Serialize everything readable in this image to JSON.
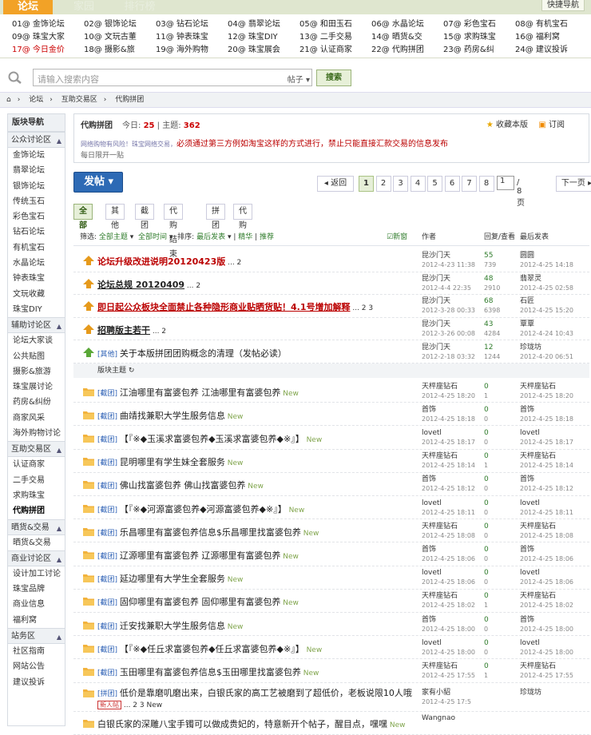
{
  "topnav": {
    "active": "论坛",
    "home": "家园",
    "rank": "排行榜",
    "quick": "快捷导航"
  },
  "forum_list": [
    [
      "01@ 金饰论坛",
      "02@ 银饰论坛",
      "03@ 钻石论坛",
      "04@ 翡翠论坛",
      "05@ 和田玉石",
      "06@ 水晶论坛",
      "07@ 彩色宝石",
      "08@ 有机宝石"
    ],
    [
      "09@ 珠宝大家",
      "10@ 文玩古董",
      "11@ 钟表珠宝",
      "12@ 珠宝DIY",
      "13@ 二手交易",
      "14@ 晒货&交",
      "15@ 求购珠宝",
      "16@ 福利窝"
    ],
    [
      "17@ 今日金价",
      "18@ 摄影&旅",
      "19@ 海外购物",
      "20@ 珠宝展会",
      "21@ 认证商家",
      "22@ 代购拼团",
      "23@ 药房&纠",
      "24@ 建议投诉"
    ]
  ],
  "search": {
    "placeholder": "请输入搜索内容",
    "scope": "帖子",
    "button": "搜索"
  },
  "breadcrumb": [
    "论坛",
    "互助交易区",
    "代购拼团"
  ],
  "sidebar": {
    "title": "版块导航",
    "groups": [
      {
        "name": "公众讨论区",
        "items": [
          "金饰论坛",
          "翡翠论坛",
          "银饰论坛",
          "传统玉石",
          "彩色宝石",
          "钻石论坛",
          "有机宝石",
          "水晶论坛",
          "钟表珠宝",
          "文玩收藏",
          "珠宝DIY"
        ]
      },
      {
        "name": "辅助讨论区",
        "items": [
          "论坛大家谈",
          "公共贴图",
          "摄影&旅游",
          "珠宝展讨论",
          "药房&纠纷",
          "商家风采",
          "海外购物讨论"
        ]
      },
      {
        "name": "互助交易区",
        "items": [
          "认证商家",
          "二手交易",
          "求购珠宝",
          "代购拼团"
        ]
      },
      {
        "name": "晒货&交易",
        "items": [
          "晒货&交易"
        ]
      },
      {
        "name": "商业讨论区",
        "items": [
          "设计加工讨论",
          "珠宝品牌",
          "商业信息",
          "福利窝"
        ]
      },
      {
        "name": "站务区",
        "items": [
          "社区指南",
          "网站公告",
          "建议投诉"
        ]
      }
    ]
  },
  "board": {
    "name": "代购拼团",
    "today_label": "今日:",
    "today": "25",
    "topics_label": "主题:",
    "topics": "362",
    "fav": "收藏本版",
    "subscribe": "订阅",
    "warning_prefix": "网络购物有风险！珠宝网络交易，",
    "warning": "必须通过第三方例如淘宝这样的方式进行，禁止只能直接汇款交易的信息发布",
    "daily": "每日限开一贴"
  },
  "post_button": "发帖",
  "pager": {
    "prev": "返回",
    "pages": [
      "1",
      "2",
      "3",
      "4",
      "5",
      "6",
      "7",
      "8"
    ],
    "input": "1",
    "total": "/ 8 页",
    "next": "下一页"
  },
  "filters": [
    "全部",
    "其他",
    "截团",
    "代购结束",
    "拼团",
    "代购"
  ],
  "thead": {
    "filter": "筛选:",
    "all_topics": "全部主题",
    "all_time": "全部时间",
    "sort": "排序:",
    "latest": "最后发表",
    "digest": "精华",
    "recommend": "推荐",
    "newwin": "新窗",
    "author": "作者",
    "replies": "回复/查看",
    "last": "最后发表"
  },
  "sticky": [
    {
      "tag": "",
      "title": "论坛升级改进说明20120423版",
      "pages": "... 2",
      "author": "昆沙门天",
      "date": "2012-4-23 11:38",
      "r": "55",
      "v": "739",
      "lp": "圆圆",
      "lpd": "2012-4-25 14:18",
      "style": "red"
    },
    {
      "tag": "",
      "title": "论坛总规 20120409",
      "pages": "... 2",
      "author": "昆沙门天",
      "date": "2012-4-4 22:35",
      "r": "48",
      "v": "2910",
      "lp": "翡翠灵",
      "lpd": "2012-4-25 02:58",
      "style": "und"
    },
    {
      "tag": "",
      "title": "即日起公众板块全面禁止各种隐形商业贴晒货贴！4.1号增加解释",
      "pages": "... 2  3",
      "author": "昆沙门天",
      "date": "2012-3-28 00:33",
      "r": "68",
      "v": "6398",
      "lp": "石匠",
      "lpd": "2012-4-25 15:20",
      "style": "redund"
    },
    {
      "tag": "",
      "title": "招聘版主若干",
      "pages": "... 2",
      "author": "昆沙门天",
      "date": "2012-3-26 00:08",
      "r": "43",
      "v": "4284",
      "lp": "覃覃",
      "lpd": "2012-4-24 10:43",
      "style": "und"
    },
    {
      "tag": "[其他]",
      "title": "关于本版拼团团购概念的清理（发帖必读）",
      "pages": "",
      "author": "昆沙门天",
      "date": "2012-2-18 03:32",
      "r": "12",
      "v": "1244",
      "lp": "珍珑坊",
      "lpd": "2012-4-20 06:51",
      "style": "plain"
    }
  ],
  "subsection": "版块主题",
  "threads": [
    {
      "tag": "[截团]",
      "title": "江油哪里有富婆包养  江油哪里有富婆包养",
      "new": "New",
      "author": "天枰座钻石",
      "date": "2012-4-25 18:20",
      "r": "0",
      "v": "1",
      "lp": "天枰座钻石",
      "lpd": "2012-4-25 18:20"
    },
    {
      "tag": "[截团]",
      "title": "曲靖找兼职大学生服务信息",
      "new": "New",
      "author": "首饰",
      "date": "2012-4-25 18:18",
      "r": "0",
      "v": "0",
      "lp": "首饰",
      "lpd": "2012-4-25 18:18"
    },
    {
      "tag": "[截团]",
      "title": "【『※◆玉溪求富婆包养◆玉溪求富婆包养◆※』】",
      "new": "New",
      "author": "lovetl",
      "date": "2012-4-25 18:17",
      "r": "0",
      "v": "0",
      "lp": "lovetl",
      "lpd": "2012-4-25 18:17"
    },
    {
      "tag": "[截团]",
      "title": "昆明哪里有学生妹全套服务",
      "new": "New",
      "author": "天枰座钻石",
      "date": "2012-4-25 18:14",
      "r": "0",
      "v": "1",
      "lp": "天枰座钻石",
      "lpd": "2012-4-25 18:14"
    },
    {
      "tag": "[截团]",
      "title": "佛山找富婆包养  佛山找富婆包养",
      "new": "New",
      "author": "首饰",
      "date": "2012-4-25 18:12",
      "r": "0",
      "v": "0",
      "lp": "首饰",
      "lpd": "2012-4-25 18:12"
    },
    {
      "tag": "[截团]",
      "title": "【『※◆河源富婆包养◆河源富婆包养◆※』】",
      "new": "New",
      "author": "lovetl",
      "date": "2012-4-25 18:11",
      "r": "0",
      "v": "0",
      "lp": "lovetl",
      "lpd": "2012-4-25 18:11"
    },
    {
      "tag": "[截团]",
      "title": "乐昌哪里有富婆包养信息$乐昌哪里找富婆包养",
      "new": "New",
      "author": "天枰座钻石",
      "date": "2012-4-25 18:08",
      "r": "0",
      "v": "0",
      "lp": "天枰座钻石",
      "lpd": "2012-4-25 18:08"
    },
    {
      "tag": "[截团]",
      "title": "辽源哪里有富婆包养  辽源哪里有富婆包养",
      "new": "New",
      "author": "首饰",
      "date": "2012-4-25 18:06",
      "r": "0",
      "v": "0",
      "lp": "首饰",
      "lpd": "2012-4-25 18:06"
    },
    {
      "tag": "[截团]",
      "title": "延边哪里有大学生全套服务",
      "new": "New",
      "author": "lovetl",
      "date": "2012-4-25 18:06",
      "r": "0",
      "v": "0",
      "lp": "lovetl",
      "lpd": "2012-4-25 18:06"
    },
    {
      "tag": "[截团]",
      "title": "固仰哪里有富婆包养  固仰哪里有富婆包养",
      "new": "New",
      "author": "天枰座钻石",
      "date": "2012-4-25 18:02",
      "r": "0",
      "v": "1",
      "lp": "天枰座钻石",
      "lpd": "2012-4-25 18:02"
    },
    {
      "tag": "[截团]",
      "title": "迁安找兼职大学生服务信息",
      "new": "New",
      "author": "首饰",
      "date": "2012-4-25 18:00",
      "r": "0",
      "v": "0",
      "lp": "首饰",
      "lpd": "2012-4-25 18:00"
    },
    {
      "tag": "[截团]",
      "title": "【『※◆任丘求富婆包养◆任丘求富婆包养◆※』】",
      "new": "New",
      "author": "lovetl",
      "date": "2012-4-25 18:00",
      "r": "0",
      "v": "0",
      "lp": "lovetl",
      "lpd": "2012-4-25 18:00"
    },
    {
      "tag": "[截团]",
      "title": "玉田哪里有富婆包养信息$玉田哪里找富婆包养",
      "new": "New",
      "author": "天枰座钻石",
      "date": "2012-4-25 17:55",
      "r": "0",
      "v": "1",
      "lp": "天枰座钻石",
      "lpd": "2012-4-25 17:55"
    },
    {
      "tag": "[拼团]",
      "title": "低价是靠磨叽磨出来，白银氏家的高工艺被磨到了超低价，老板说限10人哦",
      "new": "",
      "extra_badge": "新人帖",
      "pages2": "... 2  3  New",
      "author": "家有小貂",
      "date": "2012-4-25 17:5",
      "r": "",
      "v": "",
      "lp": "珍珑坊",
      "lpd": ""
    },
    {
      "tag": "",
      "title": "白银氏家的深雕八宝手镯可以做成贵妃的，特意新开个帖子，醒目点，嘿嘿",
      "new": "New",
      "author": "Wangnao",
      "date": "",
      "r": "",
      "v": "",
      "lp": "",
      "lpd": ""
    }
  ],
  "colors": {
    "accent_orange": "#f2a227",
    "link_blue": "#2b5fb4",
    "warn_red": "#b00000",
    "green": "#2e7b2a"
  }
}
